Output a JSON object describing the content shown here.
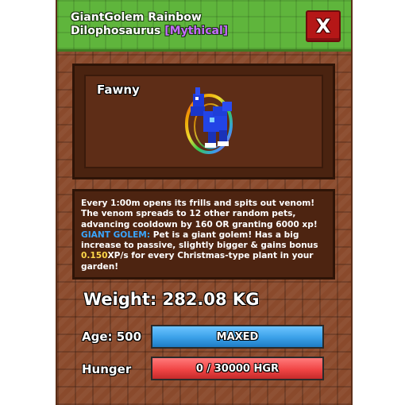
{
  "header": {
    "title_line1": "GiantGolem Rainbow",
    "title_line2": "Dilophosaurus",
    "rarity": "[Mythical]",
    "close_label": "X"
  },
  "pet": {
    "name": "Fawny",
    "image_icon": "rainbow-dilophosaurus-pet-icon"
  },
  "description": {
    "line_main": "Every 1:00m opens its frills and spits out venom! The venom spreads to 12 other random pets, advancing cooldown by 160 OR granting 6000 xp!",
    "mutation_label": "GIANT GOLEM:",
    "mutation_text": " Pet is a giant golem! Has a big increase to passive, slightly bigger & gains bonus ",
    "bonus_value": "0.150",
    "bonus_text": "XP/s for every Christmas-type plant in your garden!"
  },
  "stats": {
    "weight": "Weight: 282.08 KG",
    "age_label": "Age: 500",
    "age_bar_text": "MAXED",
    "age_fill": 1.0,
    "hunger_label": "Hunger",
    "hunger_bar_text": "0 / 30000 HGR",
    "hunger_fill": 1.0
  },
  "colors": {
    "age_fill": "#3aa0e8",
    "hunger_fill": "#f04545",
    "rarity": "#c46bff",
    "close_bg": "#b51717"
  }
}
